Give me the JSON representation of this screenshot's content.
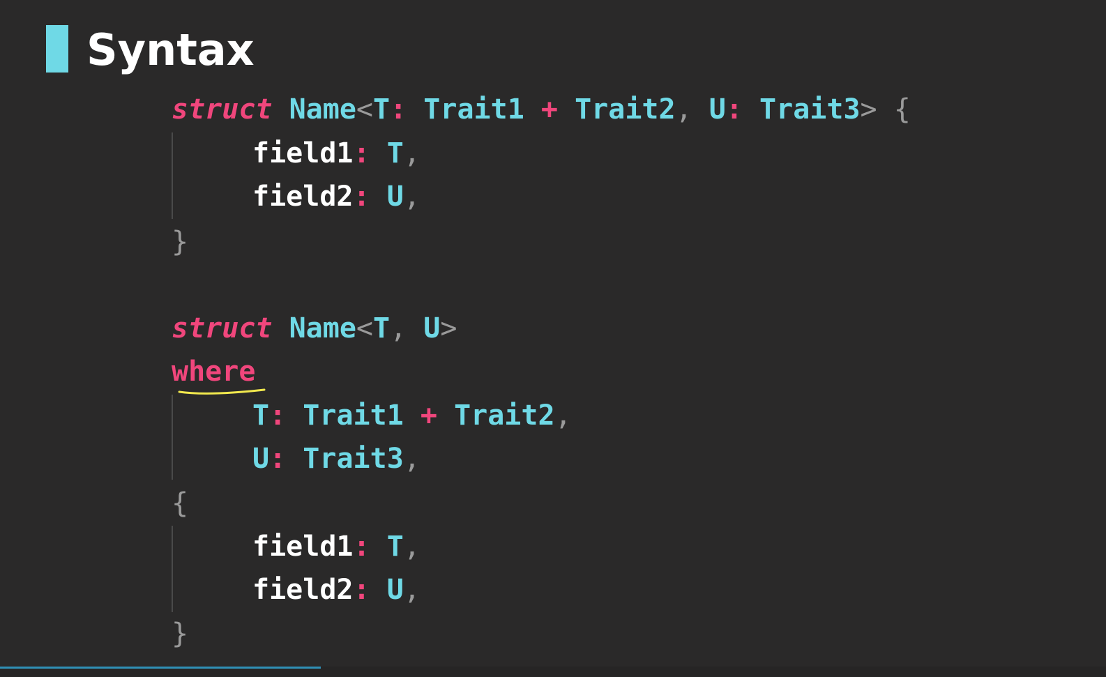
{
  "slide": {
    "title": "Syntax"
  },
  "code": {
    "block1": {
      "kw_struct": "struct",
      "name": "Name",
      "lt": "<",
      "t": "T",
      "colon1": ":",
      "trait1": "Trait1",
      "plus": "+",
      "trait2": "Trait2",
      "comma": ",",
      "u": "U",
      "colon2": ":",
      "trait3": "Trait3",
      "gt": ">",
      "open": "{",
      "field1": "field1",
      "field1_colon": ":",
      "field1_type": "T",
      "field1_comma": ",",
      "field2": "field2",
      "field2_colon": ":",
      "field2_type": "U",
      "field2_comma": ",",
      "close": "}"
    },
    "block2": {
      "kw_struct": "struct",
      "name": "Name",
      "lt": "<",
      "t": "T",
      "comma": ",",
      "u": "U",
      "gt": ">",
      "kw_where": "where",
      "c1_t": "T",
      "c1_colon": ":",
      "c1_trait1": "Trait1",
      "c1_plus": "+",
      "c1_trait2": "Trait2",
      "c1_comma": ",",
      "c2_u": "U",
      "c2_colon": ":",
      "c2_trait3": "Trait3",
      "c2_comma": ",",
      "open": "{",
      "field1": "field1",
      "field1_colon": ":",
      "field1_type": "T",
      "field1_comma": ",",
      "field2": "field2",
      "field2_colon": ":",
      "field2_type": "U",
      "field2_comma": ",",
      "close": "}"
    }
  },
  "colors": {
    "background": "#2a2929",
    "keyword": "#f0467c",
    "type": "#6fd9e6",
    "identifier": "#ffffff",
    "punctuation": "#9a9a9a",
    "title_accent": "#6fd9e6",
    "annotation_underline": "#f2e94e"
  },
  "video_progress": 0.29
}
